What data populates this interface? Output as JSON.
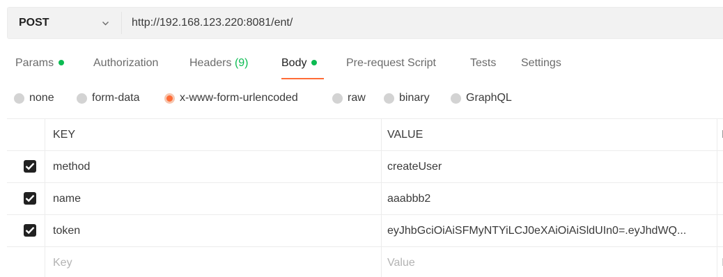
{
  "request": {
    "method": "POST",
    "url": "http://192.168.123.220:8081/ent/"
  },
  "tabs": [
    {
      "label": "Params",
      "has_dot": true
    },
    {
      "label": "Authorization"
    },
    {
      "label": "Headers",
      "count": "(9)"
    },
    {
      "label": "Body",
      "has_dot": true,
      "active": true
    },
    {
      "label": "Pre-request Script"
    },
    {
      "label": "Tests"
    },
    {
      "label": "Settings"
    }
  ],
  "body_types": [
    {
      "label": "none"
    },
    {
      "label": "form-data"
    },
    {
      "label": "x-www-form-urlencoded",
      "selected": true
    },
    {
      "label": "raw"
    },
    {
      "label": "binary"
    },
    {
      "label": "GraphQL"
    }
  ],
  "table": {
    "headers": {
      "key": "KEY",
      "value": "VALUE",
      "description": "D"
    },
    "rows": [
      {
        "checked": true,
        "key": "method",
        "value": "createUser"
      },
      {
        "checked": true,
        "key": "name",
        "value": "aaabbb2"
      },
      {
        "checked": true,
        "key": "token",
        "value": "eyJhbGciOiAiSFMyNTYiLCJ0eXAiOiAiSldUIn0=.eyJhdWQ..."
      }
    ],
    "new_row": {
      "key_placeholder": "Key",
      "value_placeholder": "Value",
      "desc_placeholder": "D"
    }
  },
  "colors": {
    "accent": "#ff6c37",
    "status_dot": "#0cbb52"
  },
  "icons": {
    "method_dropdown": "chevron-down-icon",
    "row_checkbox": "checkbox-checked-icon"
  }
}
